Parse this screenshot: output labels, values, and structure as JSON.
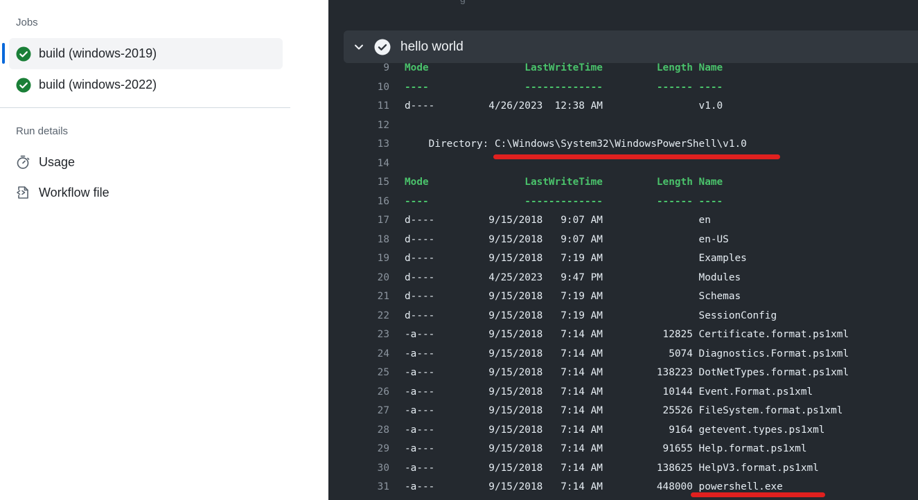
{
  "sidebar": {
    "jobs_heading": "Jobs",
    "jobs": [
      {
        "label": "build (windows-2019)",
        "status": "success",
        "active": true
      },
      {
        "label": "build (windows-2022)",
        "status": "success",
        "active": false
      }
    ],
    "run_details_heading": "Run details",
    "details": [
      {
        "label": "Usage",
        "icon": "stopwatch-icon"
      },
      {
        "label": "Workflow file",
        "icon": "file-code-icon"
      }
    ]
  },
  "log": {
    "top_text": "g",
    "step_title": "hello world",
    "lines": [
      {
        "n": "9",
        "text": "Mode                LastWriteTime         Length Name",
        "header": true
      },
      {
        "n": "10",
        "text": "----                -------------         ------ ----",
        "header": true
      },
      {
        "n": "11",
        "text": "d----         4/26/2023  12:38 AM                v1.0"
      },
      {
        "n": "12",
        "text": ""
      },
      {
        "n": "13",
        "text": "    Directory: C:\\Windows\\System32\\WindowsPowerShell\\v1.0"
      },
      {
        "n": "14",
        "text": ""
      },
      {
        "n": "15",
        "text": "Mode                LastWriteTime         Length Name",
        "header": true
      },
      {
        "n": "16",
        "text": "----                -------------         ------ ----",
        "header": true
      },
      {
        "n": "17",
        "text": "d----         9/15/2018   9:07 AM                en"
      },
      {
        "n": "18",
        "text": "d----         9/15/2018   9:07 AM                en-US"
      },
      {
        "n": "19",
        "text": "d----         9/15/2018   7:19 AM                Examples"
      },
      {
        "n": "20",
        "text": "d----         4/25/2023   9:47 PM                Modules"
      },
      {
        "n": "21",
        "text": "d----         9/15/2018   7:19 AM                Schemas"
      },
      {
        "n": "22",
        "text": "d----         9/15/2018   7:19 AM                SessionConfig"
      },
      {
        "n": "23",
        "text": "-a---         9/15/2018   7:14 AM          12825 Certificate.format.ps1xml"
      },
      {
        "n": "24",
        "text": "-a---         9/15/2018   7:14 AM           5074 Diagnostics.Format.ps1xml"
      },
      {
        "n": "25",
        "text": "-a---         9/15/2018   7:14 AM         138223 DotNetTypes.format.ps1xml"
      },
      {
        "n": "26",
        "text": "-a---         9/15/2018   7:14 AM          10144 Event.Format.ps1xml"
      },
      {
        "n": "27",
        "text": "-a---         9/15/2018   7:14 AM          25526 FileSystem.format.ps1xml"
      },
      {
        "n": "28",
        "text": "-a---         9/15/2018   7:14 AM           9164 getevent.types.ps1xml"
      },
      {
        "n": "29",
        "text": "-a---         9/15/2018   7:14 AM          91655 Help.format.ps1xml"
      },
      {
        "n": "30",
        "text": "-a---         9/15/2018   7:14 AM         138625 HelpV3.format.ps1xml"
      },
      {
        "n": "31",
        "text": "-a---         9/15/2018   7:14 AM         448000 powershell.exe"
      }
    ]
  },
  "colors": {
    "success": "#1a7f37",
    "accent": "#0969da",
    "log_bg": "#24292f",
    "log_header_green": "#4ac26b",
    "annotation_red": "#e0201f"
  }
}
